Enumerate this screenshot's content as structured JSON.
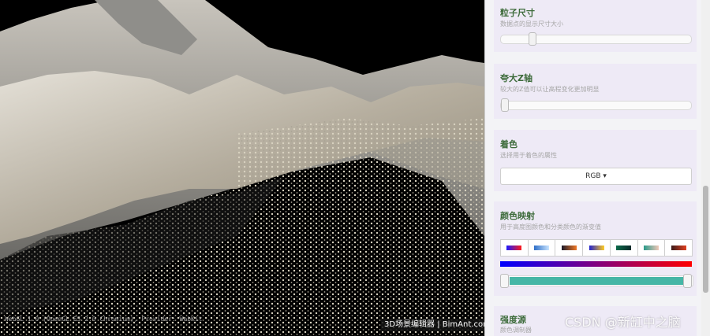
{
  "viewport": {
    "webgl_info": "WebGL 1.0 (OpenGL ES 2.0 Chromium), Provider: WebKit",
    "brand_label": "3D场景编辑器 | BimAnt.com"
  },
  "panel": {
    "point_size": {
      "title": "粒子尺寸",
      "desc": "数据点的显示尺寸大小",
      "value_fraction": 0.15
    },
    "z_exaggeration": {
      "title": "夸大Z轴",
      "desc": "较大的Z值可以让高程变化更加明显",
      "value_fraction": 0.0
    },
    "coloring": {
      "title": "着色",
      "desc": "选择用于着色的属性",
      "selected": "RGB ▾"
    },
    "color_map": {
      "title": "颜色映射",
      "desc": "用于高度图颜色和分类颜色的渐变值",
      "swatch_icons": [
        "blue-red-gradient-icon",
        "blue-white-gradient-icon",
        "dark-orange-gradient-icon",
        "blue-yellow-gradient-icon",
        "green-dark-gradient-icon",
        "teal-salmon-gradient-icon",
        "dark-red-gradient-icon"
      ],
      "swatch_colors": [
        [
          "#1a1aff",
          "#ff1a1a"
        ],
        [
          "#2f6fc8",
          "#c8e4ff"
        ],
        [
          "#1a1a2a",
          "#f07828"
        ],
        [
          "#2222cc",
          "#ffcc22"
        ],
        [
          "#0a6a4a",
          "#0a2a2a"
        ],
        [
          "#2a9a8a",
          "#f0c8b8"
        ],
        [
          "#3a1a1a",
          "#e04020"
        ]
      ],
      "gradient": [
        "#0000ff",
        "#ff0000"
      ],
      "range_low": 0.0,
      "range_high": 1.0,
      "range_color": "#46b6a6"
    },
    "intensity_source": {
      "title": "强度源",
      "desc": "颜色调制器"
    }
  },
  "watermark": "CSDN @新缸中之脑"
}
